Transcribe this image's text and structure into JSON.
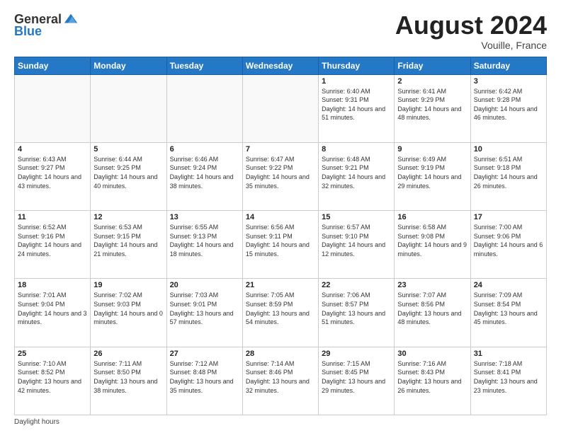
{
  "logo": {
    "general": "General",
    "blue": "Blue"
  },
  "title": "August 2024",
  "subtitle": "Vouille, France",
  "days_header": [
    "Sunday",
    "Monday",
    "Tuesday",
    "Wednesday",
    "Thursday",
    "Friday",
    "Saturday"
  ],
  "weeks": [
    [
      {
        "day": "",
        "info": ""
      },
      {
        "day": "",
        "info": ""
      },
      {
        "day": "",
        "info": ""
      },
      {
        "day": "",
        "info": ""
      },
      {
        "day": "1",
        "info": "Sunrise: 6:40 AM\nSunset: 9:31 PM\nDaylight: 14 hours and 51 minutes."
      },
      {
        "day": "2",
        "info": "Sunrise: 6:41 AM\nSunset: 9:29 PM\nDaylight: 14 hours and 48 minutes."
      },
      {
        "day": "3",
        "info": "Sunrise: 6:42 AM\nSunset: 9:28 PM\nDaylight: 14 hours and 46 minutes."
      }
    ],
    [
      {
        "day": "4",
        "info": "Sunrise: 6:43 AM\nSunset: 9:27 PM\nDaylight: 14 hours and 43 minutes."
      },
      {
        "day": "5",
        "info": "Sunrise: 6:44 AM\nSunset: 9:25 PM\nDaylight: 14 hours and 40 minutes."
      },
      {
        "day": "6",
        "info": "Sunrise: 6:46 AM\nSunset: 9:24 PM\nDaylight: 14 hours and 38 minutes."
      },
      {
        "day": "7",
        "info": "Sunrise: 6:47 AM\nSunset: 9:22 PM\nDaylight: 14 hours and 35 minutes."
      },
      {
        "day": "8",
        "info": "Sunrise: 6:48 AM\nSunset: 9:21 PM\nDaylight: 14 hours and 32 minutes."
      },
      {
        "day": "9",
        "info": "Sunrise: 6:49 AM\nSunset: 9:19 PM\nDaylight: 14 hours and 29 minutes."
      },
      {
        "day": "10",
        "info": "Sunrise: 6:51 AM\nSunset: 9:18 PM\nDaylight: 14 hours and 26 minutes."
      }
    ],
    [
      {
        "day": "11",
        "info": "Sunrise: 6:52 AM\nSunset: 9:16 PM\nDaylight: 14 hours and 24 minutes."
      },
      {
        "day": "12",
        "info": "Sunrise: 6:53 AM\nSunset: 9:15 PM\nDaylight: 14 hours and 21 minutes."
      },
      {
        "day": "13",
        "info": "Sunrise: 6:55 AM\nSunset: 9:13 PM\nDaylight: 14 hours and 18 minutes."
      },
      {
        "day": "14",
        "info": "Sunrise: 6:56 AM\nSunset: 9:11 PM\nDaylight: 14 hours and 15 minutes."
      },
      {
        "day": "15",
        "info": "Sunrise: 6:57 AM\nSunset: 9:10 PM\nDaylight: 14 hours and 12 minutes."
      },
      {
        "day": "16",
        "info": "Sunrise: 6:58 AM\nSunset: 9:08 PM\nDaylight: 14 hours and 9 minutes."
      },
      {
        "day": "17",
        "info": "Sunrise: 7:00 AM\nSunset: 9:06 PM\nDaylight: 14 hours and 6 minutes."
      }
    ],
    [
      {
        "day": "18",
        "info": "Sunrise: 7:01 AM\nSunset: 9:04 PM\nDaylight: 14 hours and 3 minutes."
      },
      {
        "day": "19",
        "info": "Sunrise: 7:02 AM\nSunset: 9:03 PM\nDaylight: 14 hours and 0 minutes."
      },
      {
        "day": "20",
        "info": "Sunrise: 7:03 AM\nSunset: 9:01 PM\nDaylight: 13 hours and 57 minutes."
      },
      {
        "day": "21",
        "info": "Sunrise: 7:05 AM\nSunset: 8:59 PM\nDaylight: 13 hours and 54 minutes."
      },
      {
        "day": "22",
        "info": "Sunrise: 7:06 AM\nSunset: 8:57 PM\nDaylight: 13 hours and 51 minutes."
      },
      {
        "day": "23",
        "info": "Sunrise: 7:07 AM\nSunset: 8:56 PM\nDaylight: 13 hours and 48 minutes."
      },
      {
        "day": "24",
        "info": "Sunrise: 7:09 AM\nSunset: 8:54 PM\nDaylight: 13 hours and 45 minutes."
      }
    ],
    [
      {
        "day": "25",
        "info": "Sunrise: 7:10 AM\nSunset: 8:52 PM\nDaylight: 13 hours and 42 minutes."
      },
      {
        "day": "26",
        "info": "Sunrise: 7:11 AM\nSunset: 8:50 PM\nDaylight: 13 hours and 38 minutes."
      },
      {
        "day": "27",
        "info": "Sunrise: 7:12 AM\nSunset: 8:48 PM\nDaylight: 13 hours and 35 minutes."
      },
      {
        "day": "28",
        "info": "Sunrise: 7:14 AM\nSunset: 8:46 PM\nDaylight: 13 hours and 32 minutes."
      },
      {
        "day": "29",
        "info": "Sunrise: 7:15 AM\nSunset: 8:45 PM\nDaylight: 13 hours and 29 minutes."
      },
      {
        "day": "30",
        "info": "Sunrise: 7:16 AM\nSunset: 8:43 PM\nDaylight: 13 hours and 26 minutes."
      },
      {
        "day": "31",
        "info": "Sunrise: 7:18 AM\nSunset: 8:41 PM\nDaylight: 13 hours and 23 minutes."
      }
    ]
  ],
  "footer": {
    "daylight_label": "Daylight hours"
  }
}
